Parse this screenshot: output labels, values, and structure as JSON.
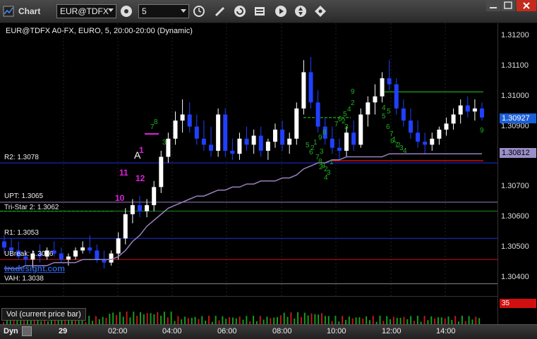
{
  "titlebar": {
    "app_title": "Chart",
    "symbol": "EUR@TDFX",
    "interval": "5"
  },
  "chart": {
    "title": "EUR@TDFX A0-FX, EURO, 5, 20:00-20:00 (Dynamic)",
    "watermark": "tradesight.com",
    "levels": [
      {
        "label": "R2: 1.3078",
        "price": 1.3078,
        "color": "#2030e0"
      },
      {
        "label": "UPT: 1.3065",
        "price": 1.3065,
        "color": "#9a7fc0"
      },
      {
        "label": "Tri-Star 2: 1.3062",
        "price": 1.3062,
        "color": "#1a8f1a"
      },
      {
        "label": "R1: 1.3053",
        "price": 1.3053,
        "color": "#2030e0"
      },
      {
        "label": "UBreak: 1.3046",
        "price": 1.3046,
        "color": "#d01010"
      },
      {
        "label": "VAH: 1.3038",
        "price": 1.3038,
        "color": "#888888"
      }
    ],
    "annotations": {
      "marker_a": "A",
      "pink_10": "10",
      "pink_11": "11",
      "pink_12": "12",
      "pink_1": "1",
      "green_labels": [
        "9",
        "8",
        "7",
        "3",
        "2",
        "4",
        "5",
        "6",
        "7",
        "8",
        "9",
        "1",
        "2",
        "3",
        "4",
        "5",
        "6",
        "7",
        "1",
        "2",
        "3",
        "4",
        "5",
        "6",
        "7",
        "8",
        "9",
        "2",
        "3",
        "1",
        "2",
        "3",
        "4",
        "5",
        "6",
        "7",
        "9",
        "2"
      ]
    }
  },
  "price_axis": {
    "ticks": [
      "1.31200",
      "1.31100",
      "1.31000",
      "1.30900",
      "1.30700",
      "1.30600",
      "1.30500",
      "1.30400"
    ],
    "tag_current": "1.30927",
    "tag_average": "1.30812",
    "tag_current_color": "#1b5fd8",
    "tag_average_color": "#9a8fc8"
  },
  "volume": {
    "label": "Vol (current price bar)",
    "value": "35"
  },
  "timebar": {
    "mode": "Dyn",
    "labels": [
      "29",
      "02:00",
      "04:00",
      "06:00",
      "08:00",
      "10:00",
      "12:00",
      "14:00"
    ]
  },
  "ohlc": [
    [
      1.3052,
      1.3054,
      1.3048,
      1.305
    ],
    [
      1.305,
      1.3053,
      1.3047,
      1.3049
    ],
    [
      1.3049,
      1.3052,
      1.3046,
      1.3047
    ],
    [
      1.3047,
      1.3049,
      1.3044,
      1.3046
    ],
    [
      1.3046,
      1.3049,
      1.3043,
      1.3048
    ],
    [
      1.3048,
      1.3051,
      1.3045,
      1.3047
    ],
    [
      1.3047,
      1.305,
      1.3046,
      1.3049
    ],
    [
      1.3049,
      1.3052,
      1.3047,
      1.3048
    ],
    [
      1.3048,
      1.305,
      1.3045,
      1.3046
    ],
    [
      1.3046,
      1.3048,
      1.3044,
      1.3047
    ],
    [
      1.3047,
      1.305,
      1.3046,
      1.3049
    ],
    [
      1.3049,
      1.3052,
      1.3048,
      1.305
    ],
    [
      1.305,
      1.3054,
      1.3048,
      1.3049
    ],
    [
      1.3049,
      1.3051,
      1.3045,
      1.3046
    ],
    [
      1.3046,
      1.3049,
      1.3043,
      1.3045
    ],
    [
      1.3045,
      1.3049,
      1.3044,
      1.3048
    ],
    [
      1.3048,
      1.3055,
      1.3046,
      1.3053
    ],
    [
      1.3053,
      1.3063,
      1.3051,
      1.3061
    ],
    [
      1.3061,
      1.3066,
      1.3058,
      1.3064
    ],
    [
      1.3064,
      1.3067,
      1.306,
      1.3062
    ],
    [
      1.3062,
      1.3066,
      1.306,
      1.3064
    ],
    [
      1.3064,
      1.3072,
      1.3062,
      1.307
    ],
    [
      1.307,
      1.3082,
      1.3068,
      1.308
    ],
    [
      1.308,
      1.3088,
      1.3078,
      1.3086
    ],
    [
      1.3086,
      1.3095,
      1.3084,
      1.3092
    ],
    [
      1.3092,
      1.3099,
      1.3088,
      1.3094
    ],
    [
      1.3094,
      1.3098,
      1.3088,
      1.309
    ],
    [
      1.309,
      1.3094,
      1.3084,
      1.3086
    ],
    [
      1.3086,
      1.3092,
      1.3082,
      1.3084
    ],
    [
      1.3084,
      1.309,
      1.308,
      1.3082
    ],
    [
      1.3082,
      1.3096,
      1.308,
      1.3094
    ],
    [
      1.3094,
      1.3096,
      1.308,
      1.3082
    ],
    [
      1.3082,
      1.3086,
      1.3079,
      1.3081
    ],
    [
      1.3081,
      1.3088,
      1.3079,
      1.3086
    ],
    [
      1.3086,
      1.309,
      1.3082,
      1.3084
    ],
    [
      1.3084,
      1.3089,
      1.3081,
      1.3087
    ],
    [
      1.3087,
      1.309,
      1.308,
      1.3082
    ],
    [
      1.3082,
      1.3086,
      1.3079,
      1.3085
    ],
    [
      1.3085,
      1.3091,
      1.3083,
      1.3089
    ],
    [
      1.3089,
      1.3092,
      1.3082,
      1.3084
    ],
    [
      1.3084,
      1.3088,
      1.3081,
      1.3086
    ],
    [
      1.3086,
      1.3098,
      1.3084,
      1.3096
    ],
    [
      1.3096,
      1.3112,
      1.3094,
      1.3108
    ],
    [
      1.3108,
      1.3113,
      1.3096,
      1.3098
    ],
    [
      1.3098,
      1.3102,
      1.3088,
      1.309
    ],
    [
      1.309,
      1.3093,
      1.3084,
      1.3086
    ],
    [
      1.3086,
      1.309,
      1.3081,
      1.3083
    ],
    [
      1.3083,
      1.3086,
      1.3079,
      1.3082
    ],
    [
      1.3082,
      1.309,
      1.308,
      1.3088
    ],
    [
      1.3088,
      1.3092,
      1.3082,
      1.3084
    ],
    [
      1.3084,
      1.3096,
      1.3083,
      1.3094
    ],
    [
      1.3094,
      1.31,
      1.309,
      1.3098
    ],
    [
      1.3098,
      1.3104,
      1.3094,
      1.31
    ],
    [
      1.31,
      1.3108,
      1.3098,
      1.3106
    ],
    [
      1.3106,
      1.3112,
      1.3102,
      1.3104
    ],
    [
      1.3104,
      1.3106,
      1.3094,
      1.3096
    ],
    [
      1.3096,
      1.3099,
      1.309,
      1.3092
    ],
    [
      1.3092,
      1.3096,
      1.3086,
      1.3088
    ],
    [
      1.3088,
      1.3092,
      1.3083,
      1.3085
    ],
    [
      1.3085,
      1.3088,
      1.3081,
      1.3084
    ],
    [
      1.3084,
      1.3088,
      1.3082,
      1.3086
    ],
    [
      1.3086,
      1.309,
      1.3084,
      1.3089
    ],
    [
      1.3089,
      1.3093,
      1.3087,
      1.3091
    ],
    [
      1.3091,
      1.3096,
      1.3089,
      1.3094
    ],
    [
      1.3094,
      1.3099,
      1.3091,
      1.3097
    ],
    [
      1.3097,
      1.31,
      1.3093,
      1.3095
    ],
    [
      1.3095,
      1.3099,
      1.3092,
      1.3096
    ],
    [
      1.3096,
      1.3098,
      1.3092,
      1.3093
    ]
  ],
  "vwap": [
    1.3043,
    1.3043,
    1.3043,
    1.3044,
    1.3044,
    1.3044,
    1.3044,
    1.3045,
    1.3045,
    1.3045,
    1.3045,
    1.3046,
    1.3046,
    1.3046,
    1.3046,
    1.3046,
    1.3047,
    1.3049,
    1.3052,
    1.3054,
    1.3057,
    1.3059,
    1.3061,
    1.3063,
    1.3064,
    1.3065,
    1.3066,
    1.3067,
    1.3067,
    1.3068,
    1.3069,
    1.3069,
    1.307,
    1.307,
    1.3071,
    1.3071,
    1.3072,
    1.3072,
    1.3072,
    1.3073,
    1.3073,
    1.3074,
    1.3076,
    1.3077,
    1.3078,
    1.3078,
    1.3079,
    1.3079,
    1.308,
    1.308,
    1.308,
    1.308,
    1.308,
    1.308,
    1.3081,
    1.3081,
    1.3081,
    1.3081,
    1.3081,
    1.3081,
    1.3081,
    1.3081,
    1.3081,
    1.3081,
    1.3081,
    1.3081,
    1.3081,
    1.3081
  ]
}
